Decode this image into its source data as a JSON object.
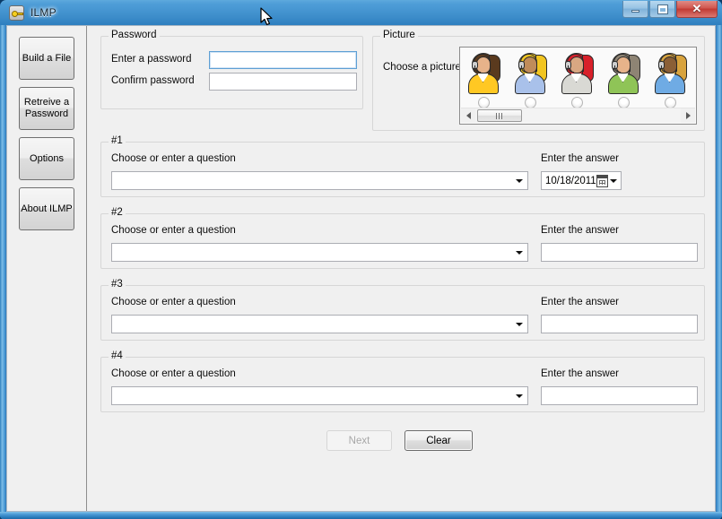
{
  "window": {
    "title": "ILMP",
    "icon": "key-icon",
    "controls": {
      "minimize": "Minimize",
      "maximize": "Maximize",
      "close": "Close",
      "close_glyph": "✕"
    }
  },
  "sidebar": {
    "items": [
      {
        "label": "Build a File",
        "name": "build-a-file"
      },
      {
        "label": "Retreive a Password",
        "name": "retrieve-a-password"
      },
      {
        "label": "Options",
        "name": "options"
      },
      {
        "label": "About ILMP",
        "name": "about-ilmp"
      }
    ]
  },
  "password_group": {
    "legend": "Password",
    "enter_label": "Enter a password",
    "enter_value": "",
    "confirm_label": "Confirm password",
    "confirm_value": ""
  },
  "picture_group": {
    "legend": "Picture",
    "choose_label": "Choose a picture",
    "avatars": [
      {
        "name": "avatar-1",
        "hair": "#5a3a1e",
        "shirt": "#ffc823",
        "selected": false
      },
      {
        "name": "avatar-2",
        "hair": "#f2c520",
        "shirt": "#a9c1ea",
        "selected": false
      },
      {
        "name": "avatar-3",
        "hair": "#d8202a",
        "shirt": "#d9d9d4",
        "selected": false
      },
      {
        "name": "avatar-4",
        "hair": "#8e8474",
        "shirt": "#8fc457",
        "selected": false
      },
      {
        "name": "avatar-5",
        "hair": "#d8a33e",
        "shirt": "#6fabe4",
        "selected": false
      }
    ],
    "scrollbar": {
      "left_arrow": "◀",
      "right_arrow": "▶"
    }
  },
  "questions": [
    {
      "legend": "#1",
      "question_label": "Choose or enter a question",
      "question_value": "",
      "answer_label": "Enter the answer",
      "answer_type": "date",
      "answer_value": "10/18/2011"
    },
    {
      "legend": "#2",
      "question_label": "Choose or enter a question",
      "question_value": "",
      "answer_label": "Enter the answer",
      "answer_type": "text",
      "answer_value": ""
    },
    {
      "legend": "#3",
      "question_label": "Choose or enter a question",
      "question_value": "",
      "answer_label": "Enter the answer",
      "answer_type": "text",
      "answer_value": ""
    },
    {
      "legend": "#4",
      "question_label": "Choose or enter a question",
      "question_value": "",
      "answer_label": "Enter the answer",
      "answer_type": "text",
      "answer_value": ""
    }
  ],
  "actions": {
    "next_label": "Next",
    "next_enabled": false,
    "clear_label": "Clear",
    "clear_enabled": true
  },
  "colors": {
    "title_glass": "#4f9ed8",
    "close_red": "#c03a33",
    "client_bg": "#f0f0f0",
    "focus_border": "#5e9fd4"
  }
}
